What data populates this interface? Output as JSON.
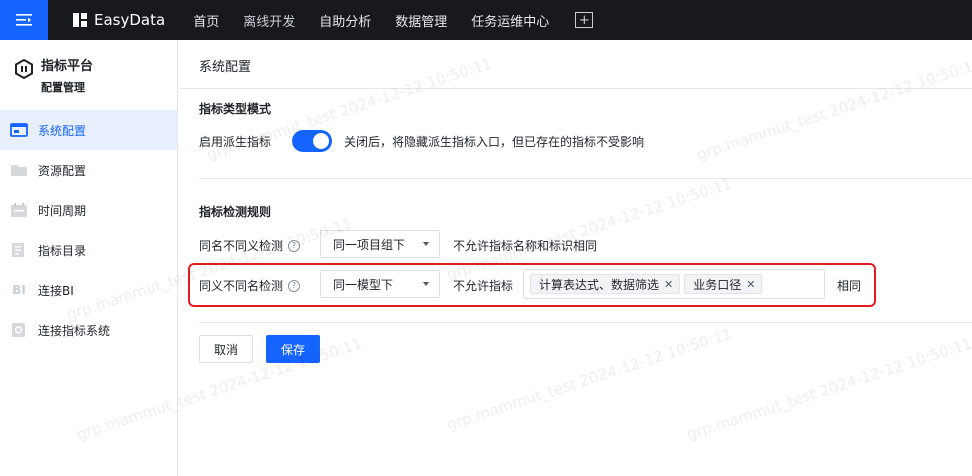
{
  "topbar": {
    "logo_text": "EasyData",
    "nav": [
      "首页",
      "离线开发",
      "自助分析",
      "数据管理",
      "任务运维中心"
    ],
    "add_symbol": "+"
  },
  "sidebar": {
    "title": "指标平台",
    "subtitle": "配置管理",
    "items": [
      {
        "label": "系统配置",
        "icon": "system-config-icon",
        "active": true
      },
      {
        "label": "资源配置",
        "icon": "folder-icon",
        "active": false
      },
      {
        "label": "时间周期",
        "icon": "calendar-icon",
        "active": false
      },
      {
        "label": "指标目录",
        "icon": "catalog-icon",
        "active": false
      },
      {
        "label": "连接BI",
        "icon": "bi-icon",
        "icon_text": "BI",
        "active": false
      },
      {
        "label": "连接指标系统",
        "icon": "link-icon",
        "active": false
      }
    ]
  },
  "main": {
    "page_title": "系统配置",
    "section1": {
      "title": "指标类型模式",
      "derived_label": "启用派生指标",
      "derived_enabled": true,
      "derived_hint": "关闭后，将隐藏派生指标入口，但已存在的指标不受影响"
    },
    "section2": {
      "title": "指标检测规则",
      "rule1": {
        "label": "同名不同义检测",
        "select_value": "同一项目组下",
        "hint": "不允许指标名称和标识相同"
      },
      "rule2": {
        "label": "同义不同名检测",
        "select_value": "同一模型下",
        "prefix": "不允许指标",
        "tags": [
          "计算表达式、数据筛选",
          "业务口径"
        ],
        "suffix": "相同"
      }
    },
    "cancel_label": "取消",
    "save_label": "保存"
  },
  "watermark_text": "grp.mammut_test 2024-12-12 10:50:11",
  "colors": {
    "accent": "#1664ff",
    "topbar_bg": "#17191d",
    "highlight_border": "#e31b23",
    "active_bg": "#e8f0ff"
  }
}
